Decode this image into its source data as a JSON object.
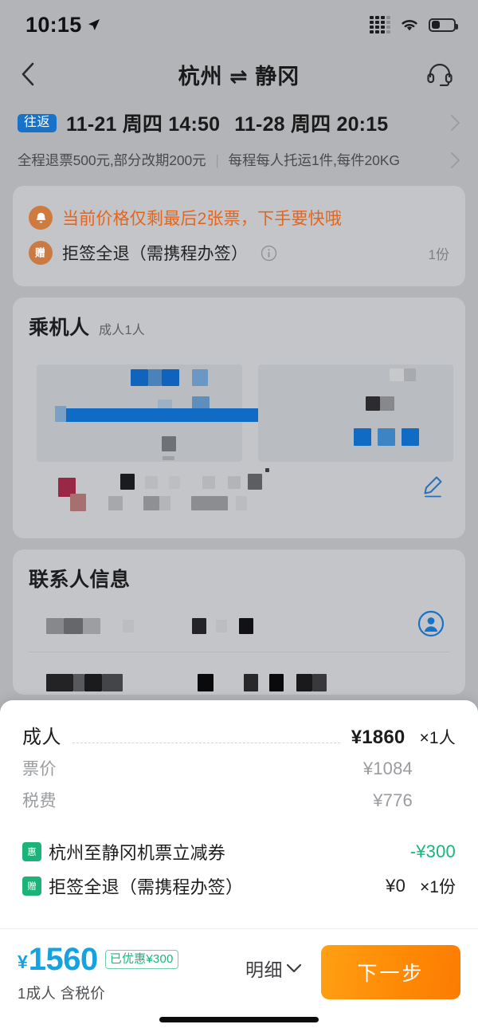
{
  "status_bar": {
    "time": "10:15",
    "location_icon": "location-arrow-icon",
    "signal_icon": "cellular-signal-icon",
    "wifi_icon": "wifi-icon",
    "battery_icon": "battery-icon"
  },
  "nav": {
    "back_icon": "chevron-left-icon",
    "title": "杭州 ⇌ 静冈",
    "support_icon": "headset-icon"
  },
  "flight_header": {
    "trip_type_tag": "往返",
    "depart": "11-21 周四 14:50",
    "return": "11-28 周四 20:15",
    "rules_refund": "全程退票500元,部分改期200元",
    "rules_separator": "|",
    "rules_baggage": "每程每人托运1件,每件20KG",
    "chevron_icon": "chevron-right-icon"
  },
  "alert_card": {
    "bell_icon": "bell-icon",
    "urgency_text": "当前价格仅剩最后2张票，下手要快哦",
    "gift_icon_label": "赠",
    "gift_title": "拒签全退（需携程办签）",
    "info_icon": "info-circle-icon",
    "gift_qty": "1份"
  },
  "passenger_section": {
    "title": "乘机人",
    "subtitle": "成人1人",
    "edit_icon": "pencil-edit-icon",
    "redacted": true
  },
  "contact_section": {
    "title": "联系人信息",
    "person_icon": "person-circle-icon",
    "redacted": true
  },
  "price_sheet": {
    "adult_row": {
      "label": "成人",
      "amount": "¥1860",
      "qty": "×1人"
    },
    "sub_rows": [
      {
        "label": "票价",
        "amount": "¥1084"
      },
      {
        "label": "税费",
        "amount": "¥776"
      }
    ],
    "discount_rows": [
      {
        "badge": "惠",
        "name": "杭州至静冈机票立减券",
        "amount": "-¥300",
        "qty": "",
        "amount_color": "green"
      },
      {
        "badge": "赠",
        "name": "拒签全退（需携程办签）",
        "amount": "¥0",
        "qty": "×1份",
        "amount_color": "dark"
      }
    ]
  },
  "bottom_bar": {
    "currency": "¥",
    "total": "1560",
    "saved_badge": "已优惠¥300",
    "sub_text": "1成人 含税价",
    "detail_label": "明细",
    "detail_chevron_icon": "chevron-down-icon",
    "cta_label": "下一步",
    "home_indicator": "home-indicator"
  },
  "colors": {
    "page_bg": "#b2b4b8",
    "card_bg": "#c3c5c8",
    "tag_blue": "#1872c8",
    "alert_orange": "#e2661f",
    "icon_circle_orange": "#cf7b3f",
    "green": "#14b879",
    "badge_green": "#1cb37a",
    "total_blue": "#14a2e0",
    "cta_orange": "#ff8a06",
    "link_blue": "#1872c8"
  }
}
